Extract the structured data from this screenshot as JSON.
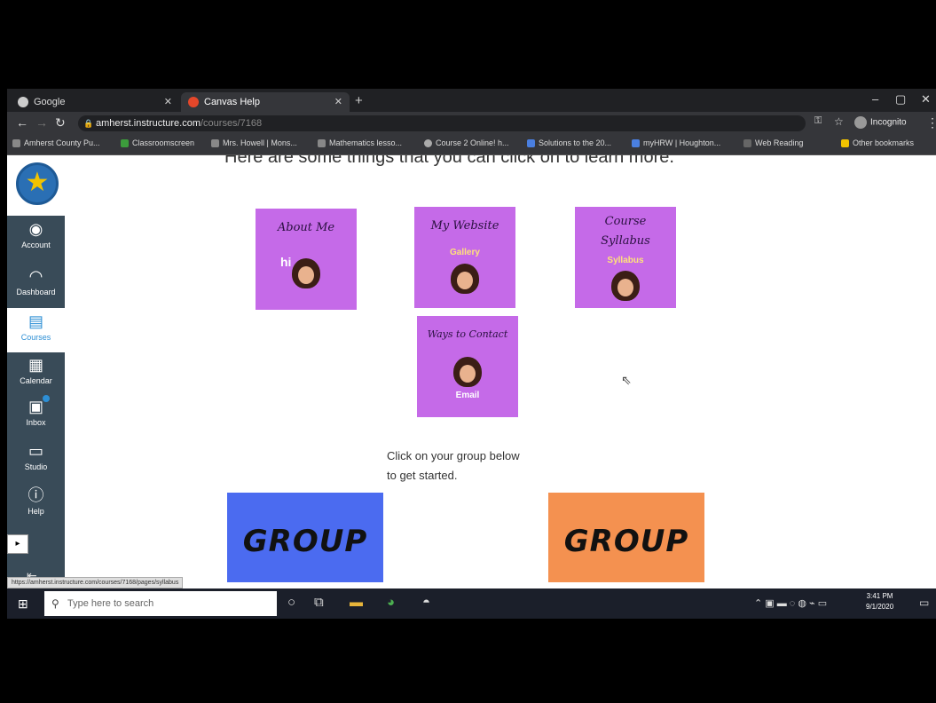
{
  "browser": {
    "tabs": [
      {
        "label": "Google",
        "active": false
      },
      {
        "label": "Canvas Help",
        "active": true
      }
    ],
    "new_tab": "+",
    "window_controls": [
      "–",
      "▢",
      "✕"
    ],
    "address": {
      "domain": "amherst.instructure.com",
      "path": "/courses/7168"
    },
    "profile": "Incognito",
    "bookmarks": [
      "Amherst County Pu...",
      "Classroomscreen",
      "Mrs. Howell | Mons...",
      "Mathematics lesso...",
      "Course 2 Online! h...",
      "Solutions to the 20...",
      "myHRW | Houghton...",
      "Web Reading",
      "Other bookmarks"
    ]
  },
  "canvas_nav": {
    "items": [
      {
        "label": "Account",
        "icon": "account-icon"
      },
      {
        "label": "Dashboard",
        "icon": "dashboard-icon"
      },
      {
        "label": "Courses",
        "icon": "courses-icon"
      },
      {
        "label": "Calendar",
        "icon": "calendar-icon"
      },
      {
        "label": "Inbox",
        "icon": "inbox-icon"
      },
      {
        "label": "Studio",
        "icon": "studio-icon"
      },
      {
        "label": "Help",
        "icon": "help-icon"
      }
    ]
  },
  "content": {
    "intro": "Here are some things that you can click on to learn more.",
    "cards": [
      {
        "title": "About Me",
        "sub": "hi"
      },
      {
        "title": "My Website",
        "sub": "Gallery"
      },
      {
        "title": "Course Syllabus",
        "sub": "Syllabus"
      },
      {
        "title": "Ways to Contact",
        "sub": "Email"
      }
    ],
    "prompt_line1": "Click on your group below",
    "prompt_line2": "to get started.",
    "groups": [
      {
        "label": "GROUP",
        "color": "#4b6bf0"
      },
      {
        "label": "GROUP",
        "color": "#f49150"
      }
    ],
    "status_url": "https://amherst.instructure.com/courses/7168/pages/syllabus"
  },
  "taskbar": {
    "search_placeholder": "Type here to search",
    "time": "3:41 PM",
    "date": "9/1/2020"
  },
  "colors": {
    "card": "#c56ae8",
    "nav": "#394b58",
    "accent": "#2d8fd5"
  }
}
